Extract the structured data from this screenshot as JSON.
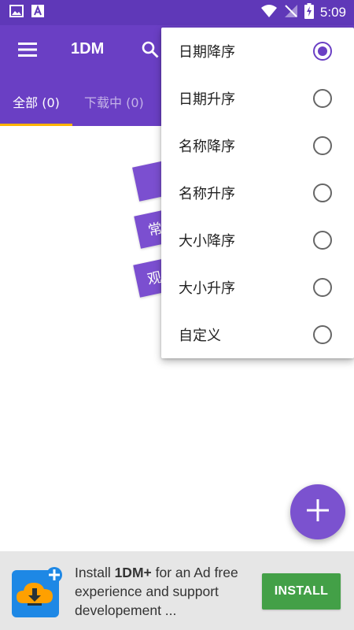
{
  "status_bar": {
    "time": "5:09",
    "left_icons": [
      "image-icon",
      "font-icon"
    ],
    "right_icons": [
      "wifi-icon",
      "no-signal-icon",
      "battery-charging-icon"
    ]
  },
  "toolbar": {
    "title": "1DM",
    "menu_icon": "hamburger-menu-icon",
    "search_icon": "search-icon"
  },
  "tabs": [
    {
      "label": "全部 (0)",
      "active": true
    },
    {
      "label": "下载中 (0)",
      "active": false
    }
  ],
  "placeholder_cards": [
    {
      "text": ""
    },
    {
      "text": "常"
    },
    {
      "text": "观"
    }
  ],
  "sort_menu": {
    "items": [
      {
        "label": "日期降序",
        "checked": true
      },
      {
        "label": "日期升序",
        "checked": false
      },
      {
        "label": "名称降序",
        "checked": false
      },
      {
        "label": "名称升序",
        "checked": false
      },
      {
        "label": "大小降序",
        "checked": false
      },
      {
        "label": "大小升序",
        "checked": false
      },
      {
        "label": "自定义",
        "checked": false
      }
    ]
  },
  "fab": {
    "icon": "plus-icon"
  },
  "ad": {
    "text_prefix": "Install ",
    "text_bold": "1DM+",
    "text_suffix": " for an Ad free experience and support developement ...",
    "install_label": "INSTALL",
    "icon": "cloud-download-plus-icon"
  },
  "colors": {
    "primary": "#6a3fc4",
    "status_bar": "#5f38b8",
    "tab_indicator": "#ffb300",
    "install_green": "#43a047"
  }
}
